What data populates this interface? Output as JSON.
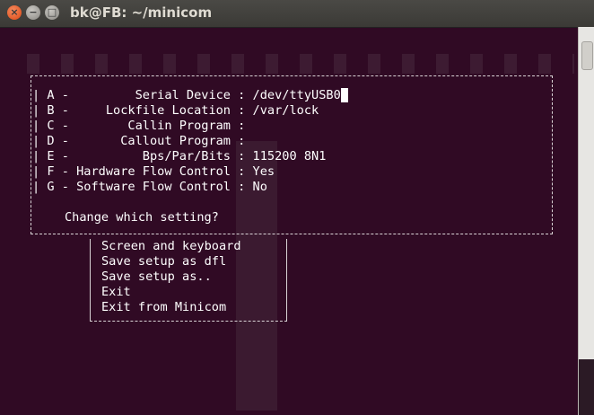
{
  "window": {
    "title": "bk@FB: ~/minicom",
    "close_glyph": "×",
    "minimize_glyph": "−",
    "maximize_glyph": "□"
  },
  "setup": {
    "rows": [
      {
        "key": "A",
        "label": "Serial Device",
        "value": "/dev/ttyUSB0"
      },
      {
        "key": "B",
        "label": "Lockfile Location",
        "value": "/var/lock"
      },
      {
        "key": "C",
        "label": "Callin Program",
        "value": ""
      },
      {
        "key": "D",
        "label": "Callout Program",
        "value": ""
      },
      {
        "key": "E",
        "label": "Bps/Par/Bits",
        "value": "115200 8N1"
      },
      {
        "key": "F",
        "label": "Hardware Flow Control",
        "value": "Yes"
      },
      {
        "key": "G",
        "label": "Software Flow Control",
        "value": "No"
      }
    ],
    "prompt": "Change which setting?"
  },
  "menu": {
    "items": [
      "Screen and keyboard",
      "Save setup as dfl",
      "Save setup as..",
      "Exit",
      "Exit from Minicom"
    ]
  },
  "colors": {
    "terminal_bg": "#300a24",
    "text": "#ffffff",
    "close_button": "#dd4814"
  }
}
